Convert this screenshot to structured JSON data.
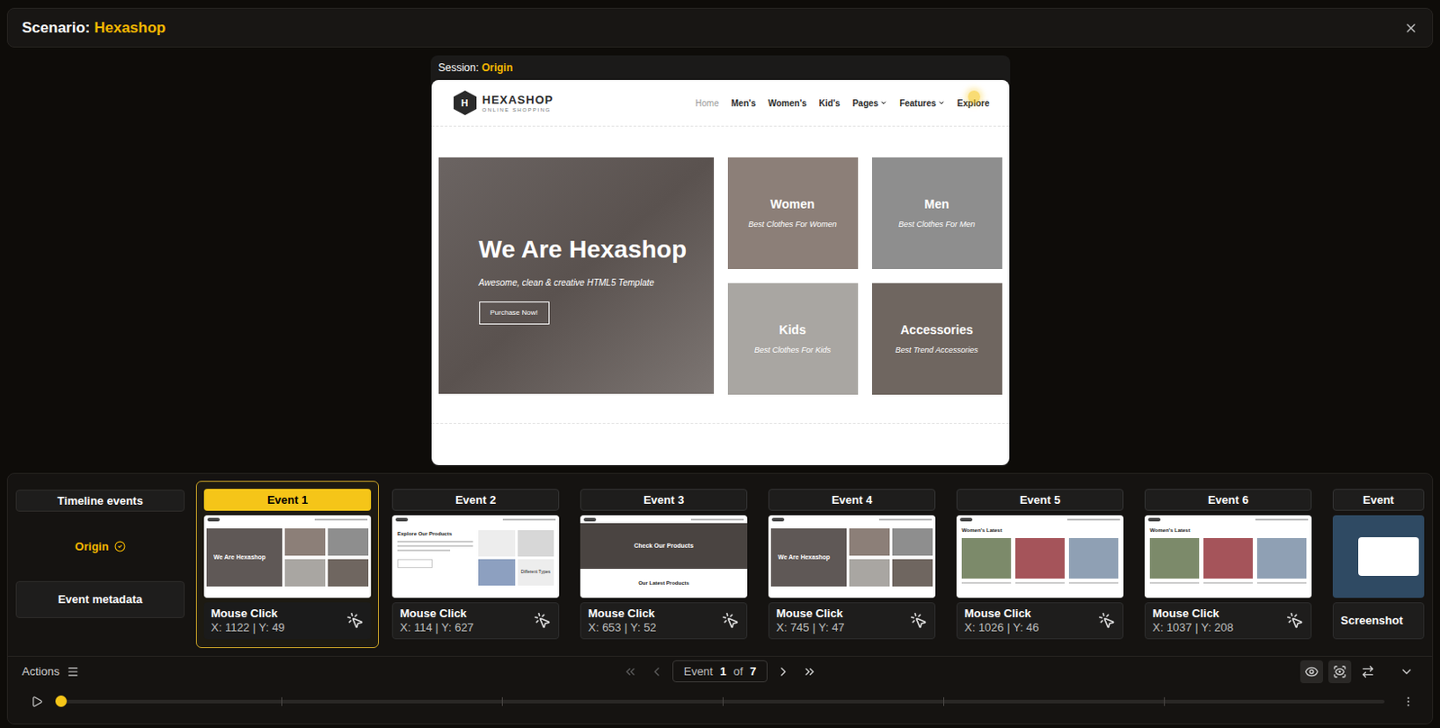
{
  "header": {
    "label": "Scenario:",
    "scenario": "Hexashop"
  },
  "session": {
    "label": "Session:",
    "name": "Origin"
  },
  "site": {
    "logo": {
      "mark": "H",
      "name": "HEXASHOP",
      "tagline": "ONLINE SHOPPING"
    },
    "nav": [
      {
        "label": "Home",
        "selected": true,
        "dropdown": false,
        "clicked": false
      },
      {
        "label": "Men's",
        "selected": false,
        "dropdown": false,
        "clicked": false
      },
      {
        "label": "Women's",
        "selected": false,
        "dropdown": false,
        "clicked": false
      },
      {
        "label": "Kid's",
        "selected": false,
        "dropdown": false,
        "clicked": false
      },
      {
        "label": "Pages",
        "selected": false,
        "dropdown": true,
        "clicked": false
      },
      {
        "label": "Features",
        "selected": false,
        "dropdown": true,
        "clicked": false
      },
      {
        "label": "Explore",
        "selected": false,
        "dropdown": false,
        "clicked": true
      }
    ],
    "hero": {
      "title": "We Are Hexashop",
      "subtitle": "Awesome, clean & creative HTML5 Template",
      "button": "Purchase Now!"
    },
    "categories": [
      {
        "title": "Women",
        "subtitle": "Best Clothes For Women",
        "color": "#8c7f78"
      },
      {
        "title": "Men",
        "subtitle": "Best Clothes For Men",
        "color": "#8e8e8e"
      },
      {
        "title": "Kids",
        "subtitle": "Best Clothes For Kids",
        "color": "#a9a6a2"
      },
      {
        "title": "Accessories",
        "subtitle": "Best Trend Accessories",
        "color": "#6f6660"
      }
    ]
  },
  "sidebar": {
    "timeline_button": "Timeline events",
    "session": {
      "name": "Origin",
      "verified": true
    },
    "metadata_button": "Event metadata"
  },
  "events": [
    {
      "label": "Event 1",
      "selected": true,
      "kind": "click",
      "action": "Mouse Click",
      "coords": "X: 1122 | Y: 49",
      "thumbnail": {
        "kind": "home",
        "heading": "We Are Hexashop"
      }
    },
    {
      "label": "Event 2",
      "selected": false,
      "kind": "click",
      "action": "Mouse Click",
      "coords": "X: 114 | Y: 627",
      "thumbnail": {
        "kind": "products",
        "heading": "Explore Our Products",
        "subheading": "Different Types"
      }
    },
    {
      "label": "Event 3",
      "selected": false,
      "kind": "click",
      "action": "Mouse Click",
      "coords": "X: 653 | Y: 52",
      "thumbnail": {
        "kind": "banner",
        "heading": "Check Our Products",
        "subheading": "Our Latest Products"
      }
    },
    {
      "label": "Event 4",
      "selected": false,
      "kind": "click",
      "action": "Mouse Click",
      "coords": "X: 745 | Y: 47",
      "thumbnail": {
        "kind": "home",
        "heading": "We Are Hexashop"
      }
    },
    {
      "label": "Event 5",
      "selected": false,
      "kind": "click",
      "action": "Mouse Click",
      "coords": "X: 1026 | Y: 46",
      "thumbnail": {
        "kind": "latest",
        "heading": "Women's Latest"
      }
    },
    {
      "label": "Event 6",
      "selected": false,
      "kind": "click",
      "action": "Mouse Click",
      "coords": "X: 1037 | Y: 208",
      "thumbnail": {
        "kind": "latest",
        "heading": "Women's Latest"
      }
    },
    {
      "label": "Event",
      "selected": false,
      "kind": "screenshot",
      "action": "Screenshot",
      "thumbnail": {
        "kind": "popup"
      }
    }
  ],
  "actions": {
    "label": "Actions"
  },
  "pager": {
    "label": "Event",
    "current": "1",
    "of": "of",
    "total": "7",
    "first_disabled": true,
    "prev_disabled": true,
    "next_disabled": false,
    "last_disabled": false
  },
  "toolbar": {
    "preview_active": true
  },
  "timeline": {
    "level": 0
  }
}
